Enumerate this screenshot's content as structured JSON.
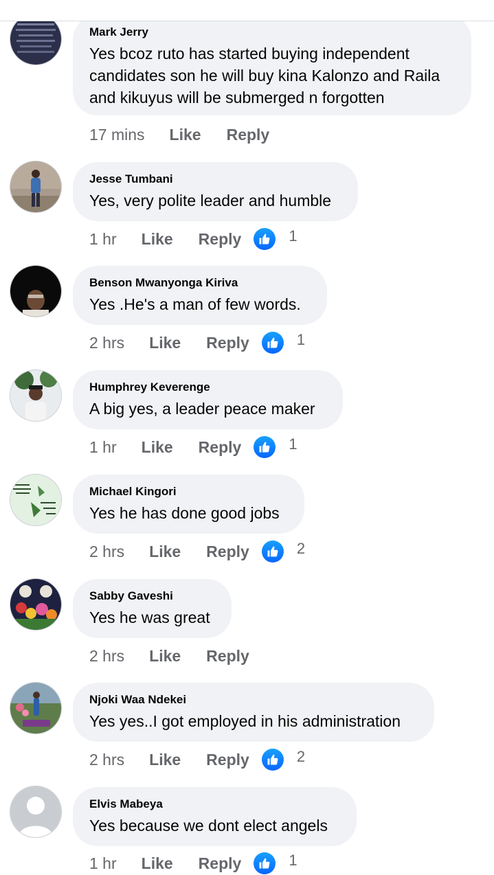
{
  "comments": [
    {
      "author": "Mark Jerry",
      "text": "Yes bcoz ruto has started buying independent candidates son he will buy kina Kalonzo and Raila and kikuyus will be submerged n forgotten",
      "time": "17 mins",
      "like_label": "Like",
      "reply_label": "Reply",
      "reactions": "",
      "avatar": "text-graphic"
    },
    {
      "author": "Jesse Tumbani",
      "text": "Yes, very polite leader and humble",
      "time": "1 hr",
      "like_label": "Like",
      "reply_label": "Reply",
      "reactions": "1",
      "avatar": "person-standing"
    },
    {
      "author": "Benson Mwanyonga Kiriva",
      "text": "Yes .He's a man of few words.",
      "time": "2 hrs",
      "like_label": "Like",
      "reply_label": "Reply",
      "reactions": "1",
      "avatar": "person-dark"
    },
    {
      "author": "Humphrey Keverenge",
      "text": "A big yes, a leader  peace maker",
      "time": "1 hr",
      "like_label": "Like",
      "reply_label": "Reply",
      "reactions": "1",
      "avatar": "person-outdoor"
    },
    {
      "author": "Michael Kingori",
      "text": "Yes he has done good jobs",
      "time": "2 hrs",
      "like_label": "Like",
      "reply_label": "Reply",
      "reactions": "2",
      "avatar": "quote-graphic"
    },
    {
      "author": "Sabby Gaveshi",
      "text": "Yes he was great",
      "time": "2 hrs",
      "like_label": "Like",
      "reply_label": "Reply",
      "reactions": "",
      "avatar": "flowers"
    },
    {
      "author": "Njoki Waa Ndekei",
      "text": "Yes yes..I got employed in his administration",
      "time": "2 hrs",
      "like_label": "Like",
      "reply_label": "Reply",
      "reactions": "2",
      "avatar": "garden"
    },
    {
      "author": "Elvis Mabeya",
      "text": "Yes because we dont elect angels",
      "time": "1 hr",
      "like_label": "Like",
      "reply_label": "Reply",
      "reactions": "1",
      "avatar": "default-silhouette"
    }
  ],
  "colors": {
    "bubble": "#f0f2f5",
    "meta_text": "#65676b",
    "like_blue": "#0866ff"
  }
}
